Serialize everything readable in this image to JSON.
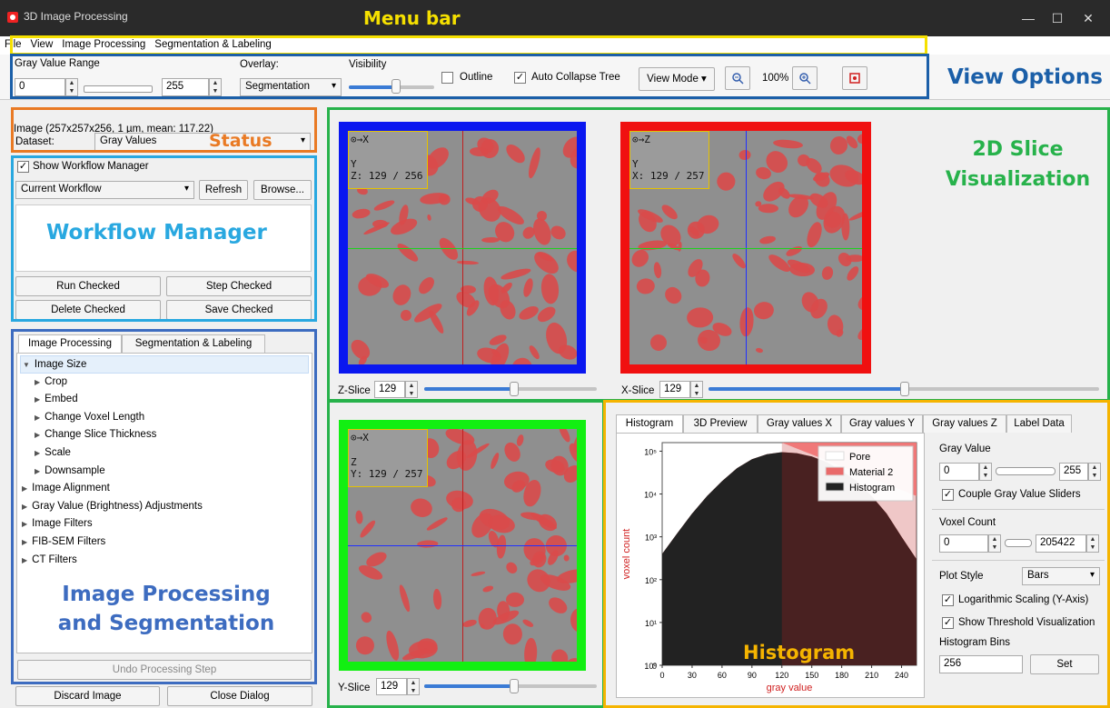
{
  "window": {
    "title": "3D Image Processing",
    "minimize": "—",
    "maximize": "☐",
    "close": "✕"
  },
  "menu": [
    "File",
    "View",
    "Image Processing",
    "Segmentation & Labeling"
  ],
  "annotations": {
    "menu_bar": "Menu bar",
    "view_options": "View Options",
    "status": "Status",
    "workflow": "Workflow Manager",
    "improc1": "Image Processing",
    "improc2": "and Segmentation",
    "slice1": "2D Slice",
    "slice2": "Visualization",
    "histogram": "Histogram"
  },
  "annotation_colors": {
    "menu_bar": "#f5e000",
    "view_options": "#1b5fa8",
    "status": "#e97a24",
    "workflow": "#29a8e0",
    "improc": "#3d6cc0",
    "slice": "#27b24b",
    "histogram": "#f5b400"
  },
  "toolbar": {
    "gray_range_label": "Gray Value Range",
    "gray_min": "0",
    "gray_max": "255",
    "overlay_label": "Overlay:",
    "overlay_value": "Segmentation",
    "visibility_label": "Visibility",
    "visibility_level": 0.55,
    "outline_label": "Outline",
    "outline_checked": false,
    "autocollapse_label": "Auto Collapse Tree",
    "autocollapse_checked": true,
    "viewmode_label": "View Mode",
    "zoom": "100%",
    "zoom_out_icon": "zoom-out-icon",
    "zoom_in_icon": "zoom-in-icon",
    "screenshot_icon": "screenshot-icon"
  },
  "status": {
    "text": "Image (257x257x256, 1 µm, mean: 117.22)",
    "dataset_label": "Dataset:",
    "dataset_value": "Gray Values"
  },
  "workflow": {
    "show_label": "Show Workflow Manager",
    "show_checked": true,
    "current": "Current Workflow",
    "refresh": "Refresh",
    "browse": "Browse...",
    "run": "Run Checked",
    "step": "Step Checked",
    "delete": "Delete Checked",
    "save": "Save Checked"
  },
  "tabs_left": [
    "Image Processing",
    "Segmentation & Labeling"
  ],
  "tree": [
    {
      "label": "Image Size",
      "level": 0,
      "expanded": true,
      "selected": true
    },
    {
      "label": "Crop",
      "level": 1
    },
    {
      "label": "Embed",
      "level": 1
    },
    {
      "label": "Change Voxel Length",
      "level": 1
    },
    {
      "label": "Change Slice Thickness",
      "level": 1
    },
    {
      "label": "Scale",
      "level": 1
    },
    {
      "label": "Downsample",
      "level": 1
    },
    {
      "label": "Image Alignment",
      "level": 0
    },
    {
      "label": "Gray Value (Brightness) Adjustments",
      "level": 0
    },
    {
      "label": "Image Filters",
      "level": 0
    },
    {
      "label": "FIB-SEM Filters",
      "level": 0
    },
    {
      "label": "CT Filters",
      "level": 0
    }
  ],
  "undo": "Undo Processing Step",
  "discard": "Discard Image",
  "close_dialog": "Close Dialog",
  "slices": {
    "z": {
      "axis_label": "X",
      "axis_label2": "Y",
      "coord": "Z: 129 / 256",
      "slider_label": "Z-Slice",
      "value": "129",
      "frac": 0.5,
      "color": "#0a17f0"
    },
    "x": {
      "axis_label": "Z",
      "axis_label2": "Y",
      "coord": "X: 129 / 257",
      "slider_label": "X-Slice",
      "value": "129",
      "frac": 0.5,
      "color": "#f01010"
    },
    "y": {
      "axis_label": "X",
      "axis_label2": "Z",
      "coord": "Y: 129 / 257",
      "slider_label": "Y-Slice",
      "value": "129",
      "frac": 0.5,
      "color": "#12ef12"
    }
  },
  "hist_tabs": [
    "Histogram",
    "3D Preview",
    "Gray values X",
    "Gray values Y",
    "Gray values Z",
    "Label Data"
  ],
  "hist_panel": {
    "gray_value_label": "Gray Value",
    "gv_min": "0",
    "gv_max": "255",
    "couple_label": "Couple Gray Value Sliders",
    "couple_checked": true,
    "voxel_count_label": "Voxel Count",
    "vc_min": "0",
    "vc_max": "205422",
    "plot_style_label": "Plot Style",
    "plot_style": "Bars",
    "log_label": "Logarithmic Scaling (Y-Axis)",
    "log_checked": true,
    "thresh_label": "Show Threshold Visualization",
    "thresh_checked": true,
    "bins_label": "Histogram Bins",
    "bins": "256",
    "set": "Set"
  },
  "chart_data": {
    "type": "area",
    "xlabel": "gray value",
    "ylabel": "voxel count",
    "x_ticks": [
      "0",
      "30",
      "60",
      "90",
      "120",
      "150",
      "180",
      "210",
      "240"
    ],
    "y_ticks": [
      "0",
      "10⁰",
      "10¹",
      "10²",
      "10³",
      "10⁴",
      "10⁵"
    ],
    "xlim": [
      0,
      255
    ],
    "y_log": true,
    "legend": [
      "Pore",
      "Material 2",
      "Histogram"
    ],
    "legend_colors": [
      "#ffffff",
      "#e96a6a",
      "#222222"
    ],
    "threshold": 120,
    "series": [
      {
        "name": "Histogram",
        "x": [
          0,
          15,
          30,
          45,
          60,
          75,
          90,
          105,
          120,
          135,
          150,
          165,
          180,
          195,
          210,
          225,
          240,
          255
        ],
        "y": [
          400,
          1200,
          3500,
          9000,
          20000,
          40000,
          65000,
          85000,
          95000,
          90000,
          75000,
          55000,
          35000,
          20000,
          9000,
          3500,
          1000,
          300
        ]
      }
    ]
  }
}
